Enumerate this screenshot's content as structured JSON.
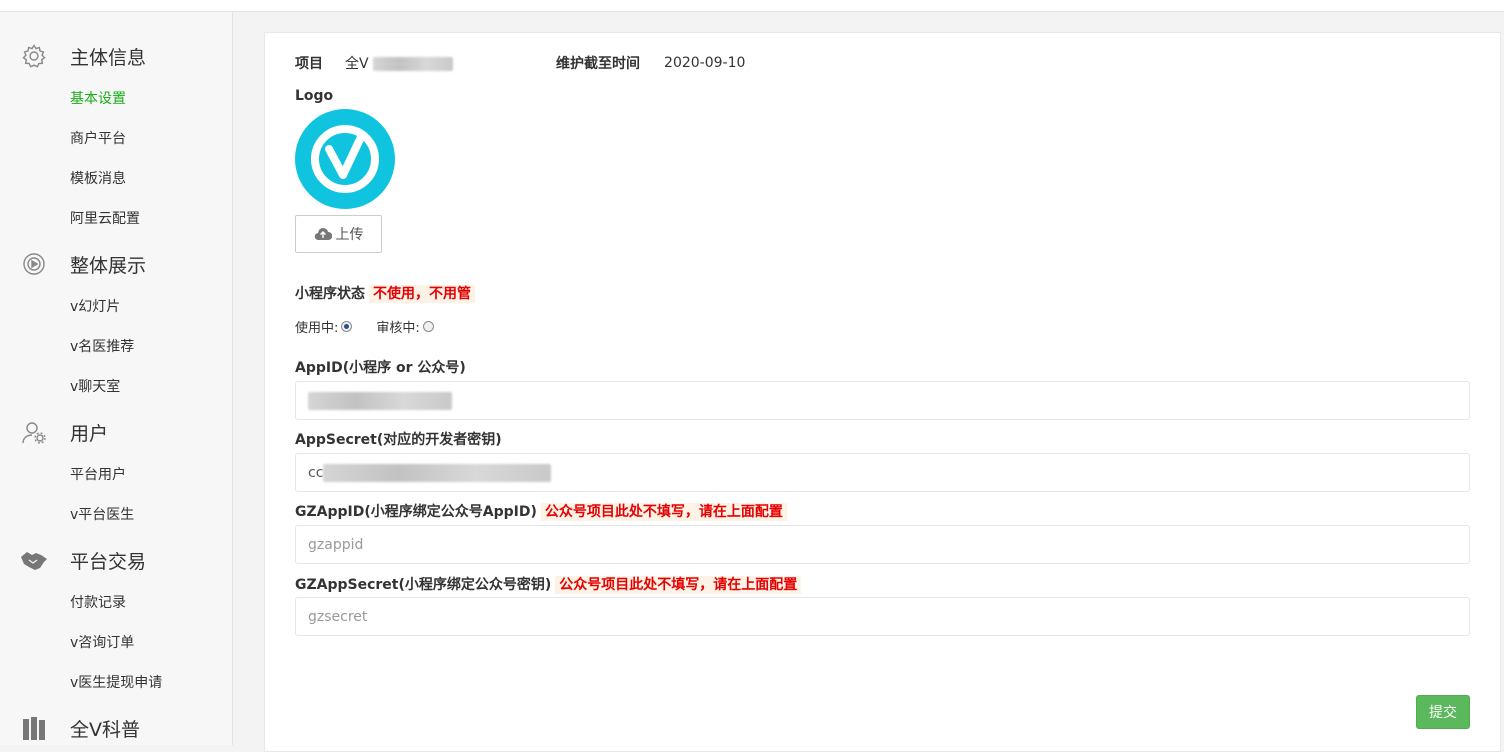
{
  "sidebar": {
    "groups": [
      {
        "title": "主体信息",
        "icon": "gear-icon",
        "items": [
          "基本设置",
          "商户平台",
          "模板消息",
          "阿里云配置"
        ],
        "active": 0
      },
      {
        "title": "整体展示",
        "icon": "display-icon",
        "items": [
          "v幻灯片",
          "v名医推荐",
          "v聊天室"
        ]
      },
      {
        "title": "用户",
        "icon": "user-settings-icon",
        "items": [
          "平台用户",
          "v平台医生"
        ]
      },
      {
        "title": "平台交易",
        "icon": "handshake-icon",
        "items": [
          "付款记录",
          "v咨询订单",
          "v医生提现申请"
        ]
      },
      {
        "title": "全V科普",
        "icon": "books-icon",
        "items": []
      }
    ]
  },
  "form": {
    "project_label": "项目",
    "project_value": "全V",
    "maintain_label": "维护截至时间",
    "maintain_value": "2020-09-10",
    "logo_label": "Logo",
    "upload_label": "上传",
    "status_label": "小程序状态",
    "status_warning": "不使用，不用管",
    "radio_in_use": "使用中:",
    "radio_reviewing": "审核中:",
    "status_selected": "使用中",
    "appid_label": "AppID(小程序 or 公众号)",
    "appsecret_label": "AppSecret(对应的开发者密钥)",
    "appsecret_prefix": "cc",
    "gzappid_label": "GZAppID(小程序绑定公众号AppID)",
    "gzappid_warning": "公众号项目此处不填写，请在上面配置",
    "gzappid_placeholder": "gzappid",
    "gzsecret_label": "GZAppSecret(小程序绑定公众号密钥)",
    "gzsecret_warning": "公众号项目此处不填写，请在上面配置",
    "gzsecret_placeholder": "gzsecret",
    "submit_label": "提交"
  },
  "colors": {
    "active_menu": "#1aad19",
    "logo_bg": "#10c4e0",
    "warning": "#e60000",
    "submit_bg": "#5cb85c"
  }
}
